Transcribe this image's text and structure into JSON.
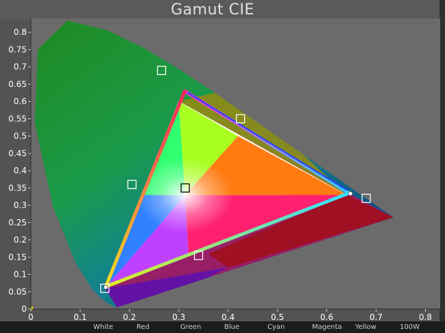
{
  "chart_data": {
    "type": "scatter",
    "title": "Gamut CIE",
    "xlim": [
      0,
      0.83
    ],
    "ylim": [
      0,
      0.84
    ],
    "xticks": [
      "0",
      "0.1",
      "0.2",
      "0.3",
      "0.4",
      "0.5",
      "0.6",
      "0.7",
      "0.8"
    ],
    "yticks": [
      "0",
      "0.05",
      "0.1",
      "0.15",
      "0.2",
      "0.25",
      "0.3",
      "0.35",
      "0.4",
      "0.45",
      "0.5",
      "0.55",
      "0.6",
      "0.65",
      "0.7",
      "0.75",
      "0.8"
    ],
    "spectral_locus": [
      [
        0.175,
        0.005
      ],
      [
        0.172,
        0.005
      ],
      [
        0.166,
        0.009
      ],
      [
        0.156,
        0.017
      ],
      [
        0.144,
        0.03
      ],
      [
        0.124,
        0.058
      ],
      [
        0.091,
        0.133
      ],
      [
        0.045,
        0.295
      ],
      [
        0.008,
        0.538
      ],
      [
        0.014,
        0.75
      ],
      [
        0.074,
        0.834
      ],
      [
        0.155,
        0.806
      ],
      [
        0.23,
        0.754
      ],
      [
        0.302,
        0.692
      ],
      [
        0.373,
        0.625
      ],
      [
        0.444,
        0.555
      ],
      [
        0.512,
        0.487
      ],
      [
        0.575,
        0.424
      ],
      [
        0.627,
        0.373
      ],
      [
        0.665,
        0.334
      ],
      [
        0.691,
        0.309
      ],
      [
        0.714,
        0.286
      ],
      [
        0.735,
        0.265
      ]
    ],
    "reference_gamut": {
      "red": [
        0.64,
        0.33
      ],
      "green": [
        0.3,
        0.6
      ],
      "blue": [
        0.15,
        0.06
      ],
      "white": [
        0.3127,
        0.329
      ]
    },
    "measured_gamut": {
      "red": [
        0.645,
        0.335
      ],
      "green": [
        0.312,
        0.63
      ],
      "blue": [
        0.152,
        0.065
      ]
    },
    "targets": [
      {
        "name": "Green",
        "x": 0.265,
        "y": 0.69
      },
      {
        "name": "Yellow",
        "x": 0.425,
        "y": 0.55
      },
      {
        "name": "Cyan",
        "x": 0.205,
        "y": 0.36
      },
      {
        "name": "White",
        "x": 0.313,
        "y": 0.35
      },
      {
        "name": "Red",
        "x": 0.68,
        "y": 0.32
      },
      {
        "name": "Magenta",
        "x": 0.34,
        "y": 0.155
      },
      {
        "name": "Blue",
        "x": 0.15,
        "y": 0.06
      }
    ],
    "measured_points": [
      {
        "name": "Red",
        "x": 0.648,
        "y": 0.334
      },
      {
        "name": "Blue",
        "x": 0.152,
        "y": 0.063
      },
      {
        "name": "100W",
        "x": 0.002,
        "y": 0.002
      }
    ],
    "legend": [
      "White",
      "Red",
      "Green",
      "Blue",
      "Cyan",
      "Magenta",
      "Yellow",
      "100W"
    ],
    "grid": false
  }
}
